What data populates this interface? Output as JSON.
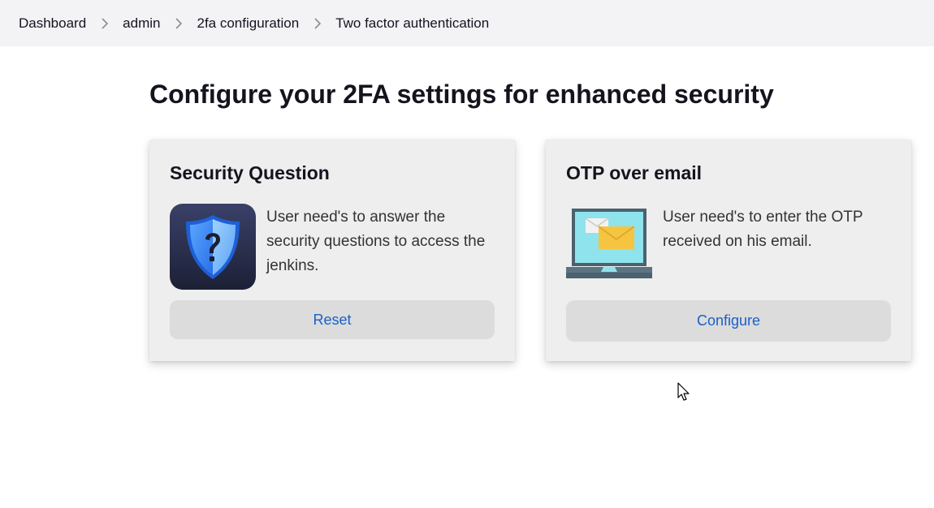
{
  "breadcrumb": {
    "items": [
      {
        "label": "Dashboard"
      },
      {
        "label": "admin"
      },
      {
        "label": "2fa configuration"
      },
      {
        "label": "Two factor authentication"
      }
    ],
    "separator_icon": "chevron-right-icon"
  },
  "page": {
    "title": "Configure your 2FA settings for enhanced security"
  },
  "cards": [
    {
      "title": "Security Question",
      "icon": "shield-question-icon",
      "description": "User need's to answer the security questions to access the jenkins.",
      "button_label": "Reset"
    },
    {
      "title": "OTP over email",
      "icon": "laptop-email-icon",
      "description": "User need's to enter the OTP received on his email.",
      "button_label": "Configure"
    }
  ],
  "colors": {
    "breadcrumb_bg": "#f3f3f5",
    "card_bg": "#eeeeee",
    "button_bg": "#dcdcdc",
    "link_blue": "#1a5fc8",
    "text_dark": "#14141f"
  }
}
